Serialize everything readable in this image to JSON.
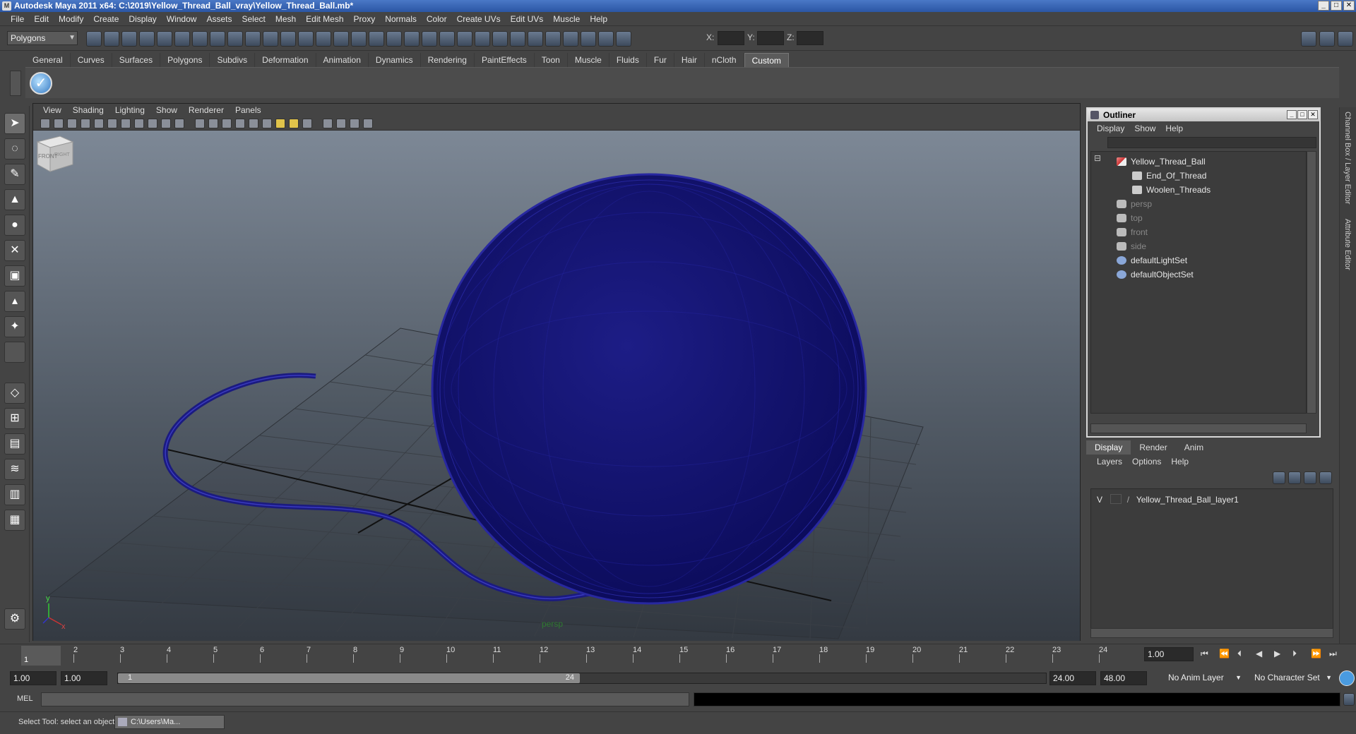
{
  "window": {
    "title": "Autodesk Maya 2011 x64: C:\\2019\\Yellow_Thread_Ball_vray\\Yellow_Thread_Ball.mb*"
  },
  "menubar": [
    "File",
    "Edit",
    "Modify",
    "Create",
    "Display",
    "Window",
    "Assets",
    "Select",
    "Mesh",
    "Edit Mesh",
    "Proxy",
    "Normals",
    "Color",
    "Create UVs",
    "Edit UVs",
    "Muscle",
    "Help"
  ],
  "toolbar": {
    "mode": "Polygons",
    "x_label": "X:",
    "y_label": "Y:",
    "z_label": "Z:"
  },
  "shelf_tabs": [
    "General",
    "Curves",
    "Surfaces",
    "Polygons",
    "Subdivs",
    "Deformation",
    "Animation",
    "Dynamics",
    "Rendering",
    "PaintEffects",
    "Toon",
    "Muscle",
    "Fluids",
    "Fur",
    "Hair",
    "nCloth",
    "Custom"
  ],
  "shelf_active": "Custom",
  "viewport": {
    "menu": [
      "View",
      "Shading",
      "Lighting",
      "Show",
      "Renderer",
      "Panels"
    ],
    "camera": "persp",
    "viewcube": {
      "front": "FRONT",
      "right": "RIGHT"
    },
    "axis": {
      "x": "x",
      "y": "y"
    }
  },
  "outliner": {
    "title": "Outliner",
    "menu": [
      "Display",
      "Show",
      "Help"
    ],
    "items": [
      {
        "label": "Yellow_Thread_Ball",
        "icon": "group-icon"
      },
      {
        "label": "End_Of_Thread",
        "icon": "mesh-icon"
      },
      {
        "label": "Woolen_Threads",
        "icon": "mesh-icon"
      },
      {
        "label": "persp",
        "icon": "camera-icon"
      },
      {
        "label": "top",
        "icon": "camera-icon"
      },
      {
        "label": "front",
        "icon": "camera-icon"
      },
      {
        "label": "side",
        "icon": "camera-icon"
      },
      {
        "label": "defaultLightSet",
        "icon": "set-icon"
      },
      {
        "label": "defaultObjectSet",
        "icon": "set-icon"
      }
    ]
  },
  "layers": {
    "tabs": [
      "Display",
      "Render",
      "Anim"
    ],
    "menu": [
      "Layers",
      "Options",
      "Help"
    ],
    "items": [
      {
        "visible": "V",
        "name": "Yellow_Thread_Ball_layer1"
      }
    ]
  },
  "right_strip": {
    "channel_box": "Channel Box / Layer Editor",
    "attribute_editor": "Attribute Editor"
  },
  "timeline": {
    "ticks": [
      "1",
      "2",
      "3",
      "4",
      "5",
      "6",
      "7",
      "8",
      "9",
      "10",
      "11",
      "12",
      "13",
      "14",
      "15",
      "16",
      "17",
      "18",
      "19",
      "20",
      "21",
      "22",
      "23",
      "24"
    ],
    "current_frame": "1.00",
    "current_marker": "1"
  },
  "range": {
    "start": "1.00",
    "playback_start": "1.00",
    "slider_start": "1",
    "slider_end": "24",
    "playback_end": "24.00",
    "end": "48.00",
    "anim_layer": "No Anim Layer",
    "character_set": "No Character Set"
  },
  "cmdline": {
    "label": "MEL"
  },
  "help": {
    "text": "Select Tool: select an object",
    "task": "C:\\Users\\Ma..."
  },
  "colors": {
    "mesh": "#1a1a7a",
    "wire": "#2c2ca6"
  }
}
